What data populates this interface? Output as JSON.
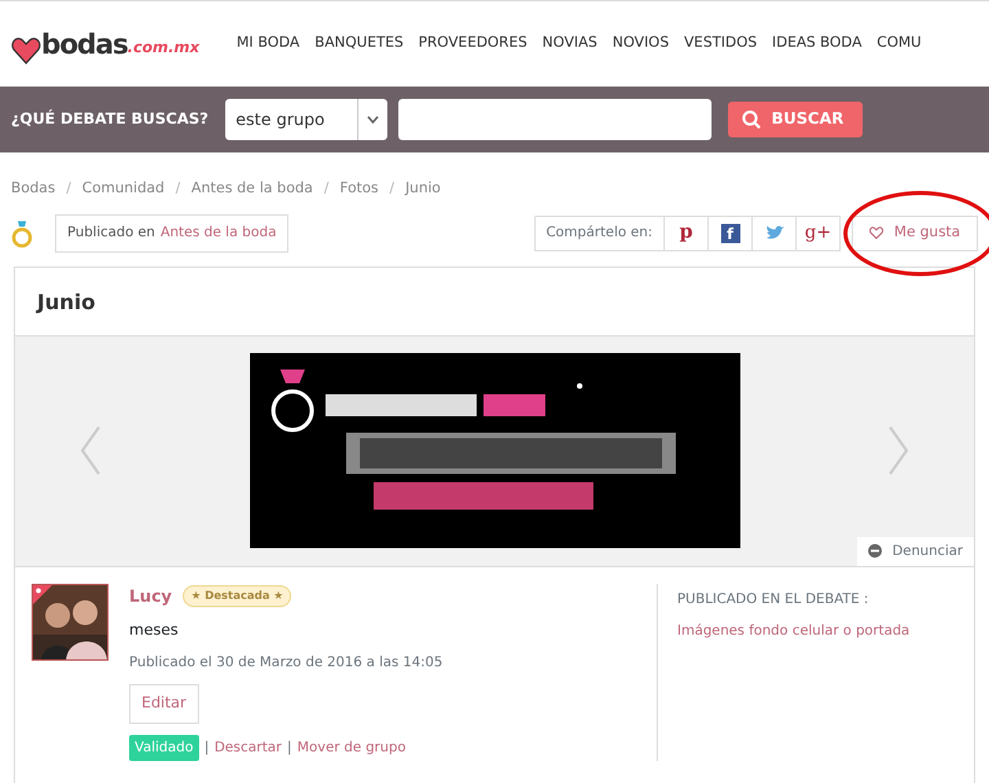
{
  "logo": {
    "name": "bodas",
    "domain": ".com.mx"
  },
  "nav": [
    "MI BODA",
    "BANQUETES",
    "PROVEEDORES",
    "NOVIAS",
    "NOVIOS",
    "VESTIDOS",
    "IDEAS BODA",
    "COMU"
  ],
  "search": {
    "label": "¿QUÉ DEBATE BUSCAS?",
    "scope": "este grupo",
    "button": "BUSCAR"
  },
  "breadcrumb": {
    "separator": "/",
    "items": [
      "Bodas",
      "Comunidad",
      "Antes de la boda",
      "Fotos",
      "Junio"
    ]
  },
  "published_in": {
    "prefix": "Publicado en",
    "link": "Antes de la boda"
  },
  "share": {
    "label": "Compártelo en:",
    "buttons": [
      {
        "kind": "pinterest",
        "glyph": "p"
      },
      {
        "kind": "facebook",
        "glyph": "f"
      },
      {
        "kind": "twitter"
      },
      {
        "kind": "google-plus",
        "glyph": "g+"
      }
    ]
  },
  "like": {
    "label": "Me gusta",
    "liked": false,
    "circled": true
  },
  "post": {
    "title": "Junio",
    "report": "Denunciar"
  },
  "author": {
    "name": "Lucy",
    "featured": true,
    "badge": "★ Destacada ★",
    "text": "meses",
    "date": "Publicado el 30 de Marzo de 2016 a las 14:05",
    "edit": "Editar",
    "status": "Validado",
    "separator": "|",
    "actions": [
      "Descartar",
      "Mover de grupo"
    ]
  },
  "debate": {
    "label": "PUBLICADO EN EL DEBATE :",
    "link": "Imágenes fondo celular o portada"
  }
}
